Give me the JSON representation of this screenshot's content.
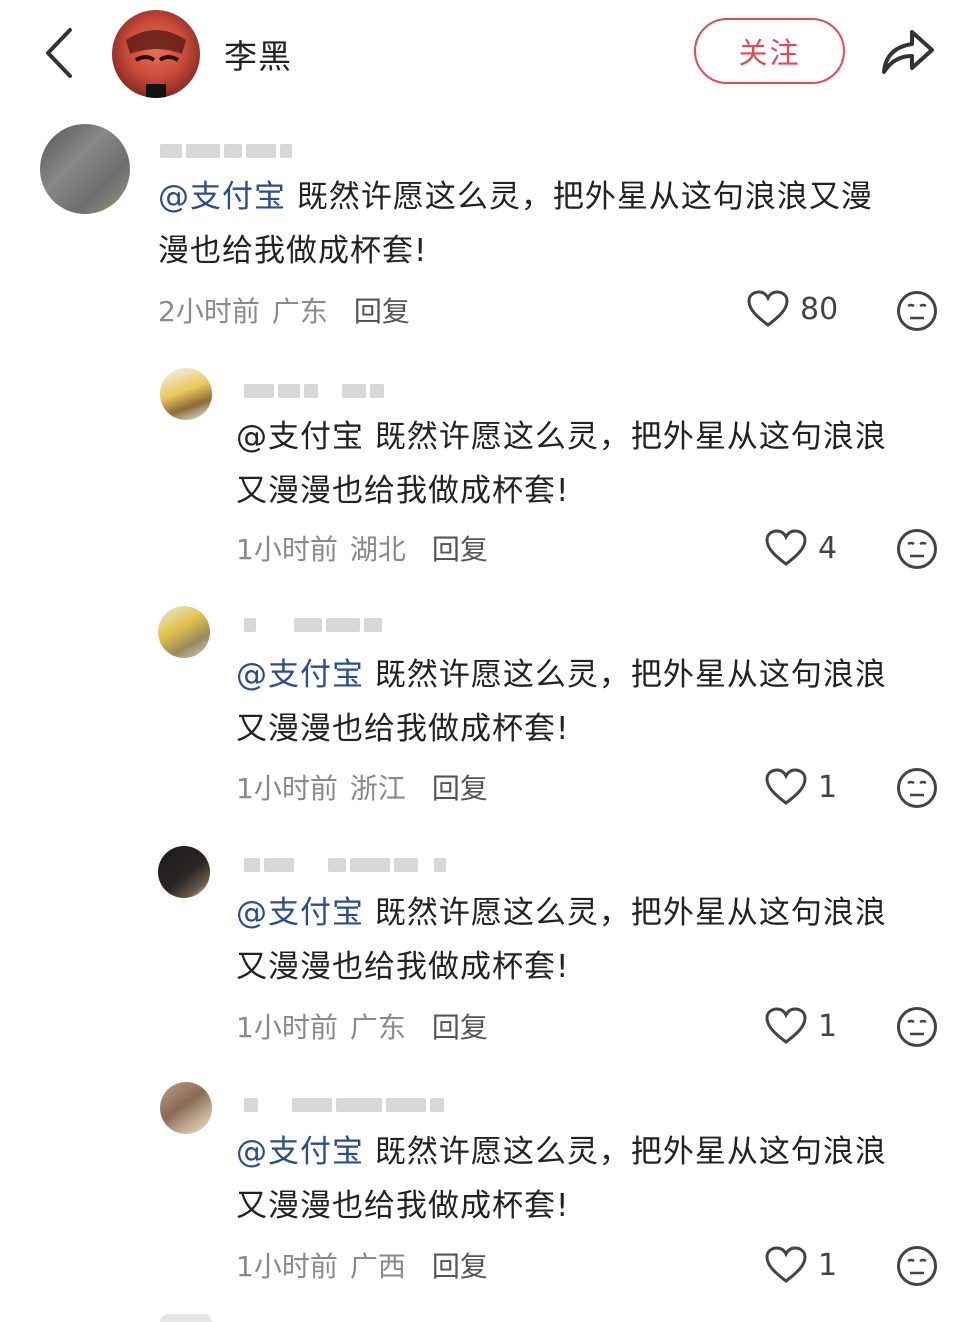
{
  "header": {
    "author_name": "李黑",
    "follow_label": "关注"
  },
  "comments": [
    {
      "mention": "@支付宝",
      "text_line1": "既然许愿这么灵，把外星从这句浪浪又漫",
      "text_line2": "漫也给我做成杯套!",
      "time": "2小时前",
      "location": "广东",
      "reply_label": "回复",
      "likes": "80"
    },
    {
      "mention": "@支付宝",
      "text_line1": "既然许愿这么灵，把外星从这句浪浪",
      "text_line2": "又漫漫也给我做成杯套!",
      "time": "1小时前",
      "location": "湖北",
      "reply_label": "回复",
      "likes": "4"
    },
    {
      "mention": "@支付宝",
      "text_line1": "既然许愿这么灵，把外星从这句浪浪",
      "text_line2": "又漫漫也给我做成杯套!",
      "time": "1小时前",
      "location": "浙江",
      "reply_label": "回复",
      "likes": "1"
    },
    {
      "mention": "@支付宝",
      "text_line1": "既然许愿这么灵，把外星从这句浪浪",
      "text_line2": "又漫漫也给我做成杯套!",
      "time": "1小时前",
      "location": "广东",
      "reply_label": "回复",
      "likes": "1"
    },
    {
      "mention": "@支付宝",
      "text_line1": "既然许愿这么灵，把外星从这句浪浪",
      "text_line2": "又漫漫也给我做成杯套!",
      "time": "1小时前",
      "location": "广西",
      "reply_label": "回复",
      "likes": "1"
    }
  ],
  "colors": {
    "accent": "#e14a57",
    "mention": "#2d4c8c",
    "meta": "#8a8a8a"
  },
  "icons": [
    "back-chevron-icon",
    "share-arrow-icon",
    "heart-icon",
    "neutral-face-icon"
  ]
}
